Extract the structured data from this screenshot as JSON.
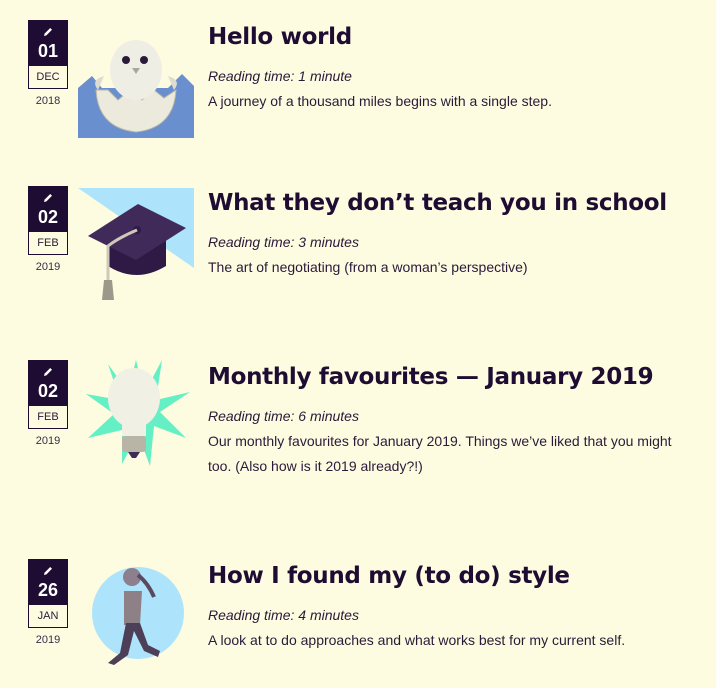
{
  "colors": {
    "background": "#fdfbe0",
    "date_badge": "#1f0c33",
    "title_text": "#1f0c33",
    "title_underline": "#f6b6e6"
  },
  "posts": [
    {
      "day": "01",
      "month": "DEC",
      "year": "2018",
      "edit_icon": "pencil-icon",
      "thumbnail": "hatching-chick",
      "title": "Hello world",
      "reading_time": "Reading time: 1 minute",
      "excerpt": "A journey of a thousand miles begins with a single step."
    },
    {
      "day": "02",
      "month": "FEB",
      "year": "2019",
      "edit_icon": "pencil-icon",
      "thumbnail": "graduation-cap",
      "title": "What they don’t teach you in school",
      "reading_time": "Reading time: 3 minutes",
      "excerpt": "The art of negotiating (from a woman’s perspective)"
    },
    {
      "day": "02",
      "month": "FEB",
      "year": "2019",
      "edit_icon": "pencil-icon",
      "thumbnail": "light-bulb",
      "title": "Monthly favourites — January 2019",
      "reading_time": "Reading time: 6 minutes",
      "excerpt": "Our monthly favourites for January 2019. Things we’ve liked that you might too. (Also how is it 2019 already?!)"
    },
    {
      "day": "26",
      "month": "JAN",
      "year": "2019",
      "edit_icon": "pencil-icon",
      "thumbnail": "woman-walking",
      "title": "How I found my (to do) style",
      "reading_time": "Reading time: 4 minutes",
      "excerpt": "A look at to do approaches and what works best for my current self."
    }
  ]
}
